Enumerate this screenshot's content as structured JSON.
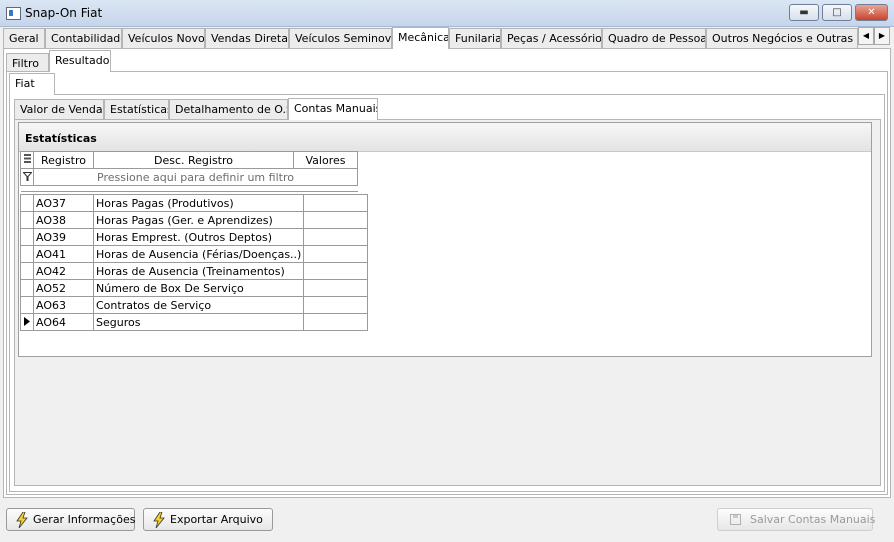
{
  "window": {
    "title": "Snap-On Fiat"
  },
  "main_tabs": [
    {
      "label": "Geral",
      "active": false
    },
    {
      "label": "Contabilidade",
      "active": false
    },
    {
      "label": "Veículos Novos",
      "active": false
    },
    {
      "label": "Vendas Diretas",
      "active": false
    },
    {
      "label": "Veículos Seminovos",
      "active": false
    },
    {
      "label": "Mecânica",
      "active": true
    },
    {
      "label": "Funilaria",
      "active": false
    },
    {
      "label": "Peças / Acessórios",
      "active": false
    },
    {
      "label": "Quadro de Pessoas",
      "active": false
    },
    {
      "label": "Outros Negócios e Outras Mar",
      "active": false
    }
  ],
  "sub_tabs": [
    {
      "label": "Filtro",
      "active": false
    },
    {
      "label": "Resultado",
      "active": true
    }
  ],
  "brand_tab": {
    "label": "Fiat"
  },
  "report_tabs": [
    {
      "label": "Valor de Vendas",
      "active": false
    },
    {
      "label": "Estatísticas",
      "active": false
    },
    {
      "label": "Detalhamento de O.S.",
      "active": false
    },
    {
      "label": "Contas Manuais",
      "active": true
    }
  ],
  "grid": {
    "caption": "Estatísticas",
    "columns": [
      "Registro",
      "Desc. Registro",
      "Valores"
    ],
    "filter_hint": "Pressione aqui para definir um filtro",
    "rows": [
      {
        "registro": "AO37",
        "desc": "Horas Pagas (Produtivos)",
        "valores": ""
      },
      {
        "registro": "AO38",
        "desc": "Horas Pagas (Ger. e Aprendizes)",
        "valores": ""
      },
      {
        "registro": "AO39",
        "desc": "Horas Emprest. (Outros Deptos)",
        "valores": ""
      },
      {
        "registro": "AO41",
        "desc": "Horas de Ausencia (Férias/Doenças..)",
        "valores": ""
      },
      {
        "registro": "AO42",
        "desc": "Horas de Ausencia (Treinamentos)",
        "valores": ""
      },
      {
        "registro": "AO52",
        "desc": "Número de Box De Serviço",
        "valores": ""
      },
      {
        "registro": "AO63",
        "desc": "Contratos de Serviço",
        "valores": ""
      },
      {
        "registro": "AO64",
        "desc": "Seguros",
        "valores": "",
        "current": true
      }
    ]
  },
  "buttons": {
    "gerar": "Gerar Informações",
    "exportar": "Exportar Arquivo",
    "salvar": "Salvar Contas Manuais"
  },
  "colors": {
    "bolt": "#f2d32a",
    "titlebar": "#c5d5ea"
  }
}
